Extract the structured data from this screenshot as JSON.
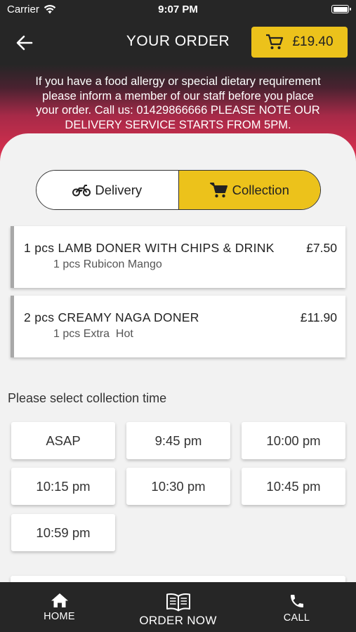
{
  "status_bar": {
    "carrier": "Carrier",
    "time": "9:07 PM"
  },
  "header": {
    "title": "YOUR ORDER",
    "cart_total": "£19.40"
  },
  "allergy_notice": {
    "lines": [
      "If you have a food allergy or special dietary requirement",
      "please inform a member of our staff before you place",
      "your order. Call us: 01429866666 PLEASE NOTE OUR",
      "DELIVERY SERVICE STARTS FROM 5PM."
    ]
  },
  "order_type": {
    "delivery_label": "Delivery",
    "collection_label": "Collection",
    "selected": "Collection"
  },
  "order_items": [
    {
      "name": "1 pcs LAMB DONER WITH CHIPS & DRINK",
      "price": "£7.50",
      "extra": "1 pcs Rubicon Mango"
    },
    {
      "name": "2 pcs CREAMY NAGA DONER",
      "price": "£11.90",
      "extra": "1 pcs Extra  Hot"
    }
  ],
  "collection_time": {
    "label": "Please select collection time",
    "slots": [
      "ASAP",
      "9:45 pm",
      "10:00 pm",
      "10:15 pm",
      "10:30 pm",
      "10:45 pm",
      "10:59 pm"
    ]
  },
  "bottom_nav": {
    "home": "HOME",
    "order_now": "ORDER NOW",
    "call": "CALL"
  },
  "colors": {
    "accent": "#ecc21b",
    "dark": "#262626",
    "banner": "#e0304f"
  },
  "icons": [
    "wifi-icon",
    "battery-icon",
    "back-arrow-icon",
    "cart-icon",
    "motorbike-icon",
    "home-icon",
    "book-icon",
    "phone-icon"
  ]
}
